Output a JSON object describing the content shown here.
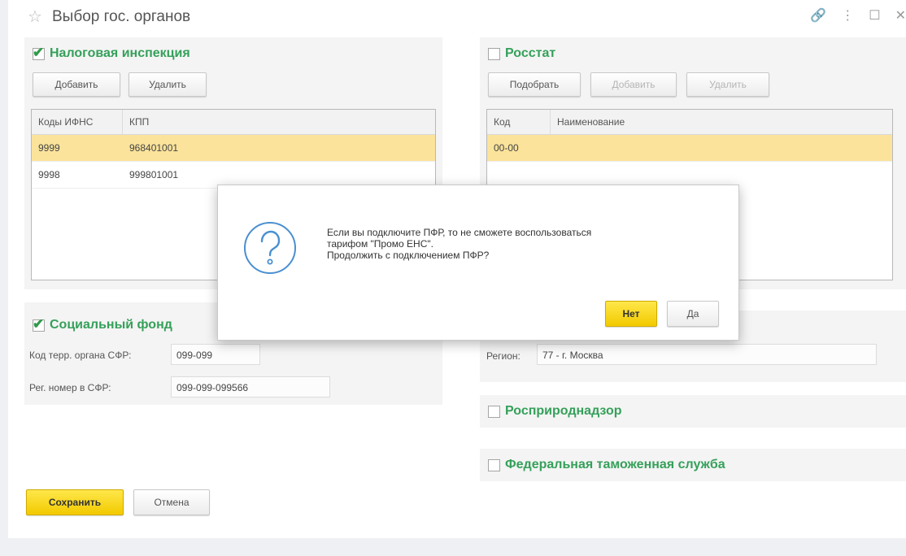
{
  "window": {
    "title": "Выбор гос. органов",
    "star_glyph": "☆",
    "icons": [
      {
        "name": "link-icon",
        "glyph": "🔗"
      },
      {
        "name": "more-icon",
        "glyph": "⋮"
      },
      {
        "name": "maximize-icon",
        "glyph": "☐"
      },
      {
        "name": "close-icon",
        "glyph": "✕"
      }
    ]
  },
  "tax": {
    "title": "Налоговая инспекция",
    "checked": true,
    "add_label": "Добавить",
    "delete_label": "Удалить",
    "columns": [
      "Коды ИФНС",
      "КПП"
    ],
    "rows": [
      {
        "code": "9999",
        "kpp": "968401001",
        "selected": true
      },
      {
        "code": "9998",
        "kpp": "999801001",
        "selected": false
      }
    ]
  },
  "rosstat": {
    "title": "Росстат",
    "checked": false,
    "select_label": "Подобрать",
    "add_label": "Добавить",
    "delete_label": "Удалить",
    "columns": [
      "Код",
      "Наименование"
    ],
    "rows": [
      {
        "code": "00-00",
        "name": "",
        "selected": true
      }
    ]
  },
  "sfr": {
    "title": "Социальный фонд",
    "checked": true,
    "terr_label": "Код терр. органа СФР:",
    "terr_value": "099-099",
    "reg_label": "Рег. номер в СФР:",
    "reg_value": "099-099-099566"
  },
  "region": {
    "label": "Регион:",
    "value": "77 - г. Москва"
  },
  "rosprirod": {
    "title": "Росприроднадзор",
    "checked": false
  },
  "customs": {
    "title": "Федеральная таможенная служба",
    "checked": false
  },
  "footer": {
    "save_label": "Сохранить",
    "cancel_label": "Отмена"
  },
  "dialog": {
    "icon": "question-icon",
    "line1": "Если вы подключите ПФР, то не сможете воспользоваться",
    "line2": "тарифом \"Промо ЕНС\".",
    "line3": "Продолжить с подключением ПФР?",
    "no_label": "Нет",
    "yes_label": "Да"
  },
  "colors": {
    "accent_green": "#35a05a",
    "selected_row": "#fbe39b",
    "primary_button": "#f5d000"
  }
}
